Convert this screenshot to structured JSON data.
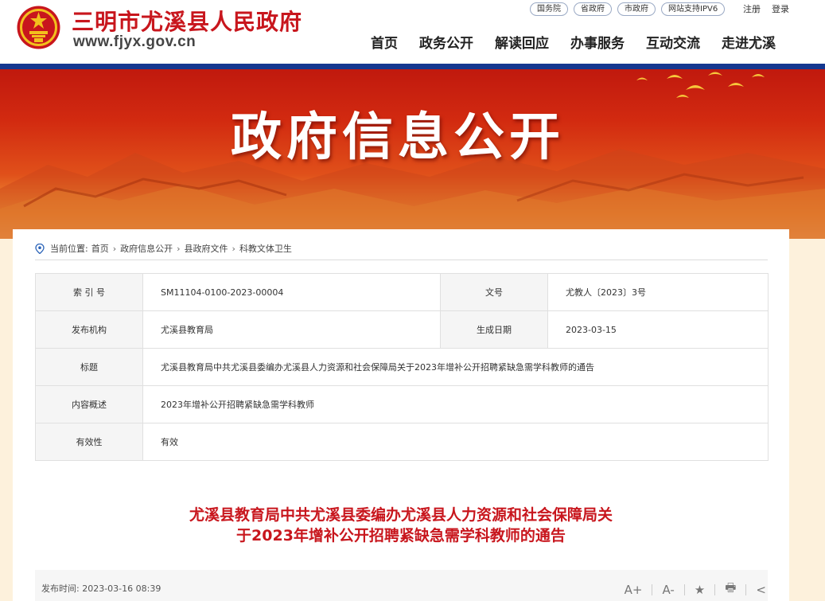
{
  "header": {
    "site_name": "三明市尤溪县人民政府",
    "domain": "www.fjyx.gov.cn",
    "top_links": [
      "国务院",
      "省政府",
      "市政府",
      "网站支持IPV6"
    ],
    "register": "注册",
    "login": "登录",
    "nav": [
      "首页",
      "政务公开",
      "解读回应",
      "办事服务",
      "互动交流",
      "走进尤溪"
    ],
    "bar_color": "#14378f"
  },
  "banner": {
    "title": "政府信息公开"
  },
  "breadcrumb": {
    "prefix": "当前位置:",
    "items": [
      "首页",
      "政府信息公开",
      "县政府文件",
      "科教文体卫生"
    ]
  },
  "meta": {
    "index_label": "索 引 号",
    "index_value": "SM11104-0100-2023-00004",
    "docno_label": "文号",
    "docno_value": "尤教人〔2023〕3号",
    "org_label": "发布机构",
    "org_value": "尤溪县教育局",
    "date_label": "生成日期",
    "date_value": "2023-03-15",
    "title_label": "标题",
    "title_value": "尤溪县教育局中共尤溪县委编办尤溪县人力资源和社会保障局关于2023年增补公开招聘紧缺急需学科教师的通告",
    "summary_label": "内容概述",
    "summary_value": "2023年增补公开招聘紧缺急需学科教师",
    "validity_label": "有效性",
    "validity_value": "有效"
  },
  "article": {
    "title_line1": "尤溪县教育局中共尤溪县委编办尤溪县人力资源和社会保障局关",
    "title_line2": "于2023年增补公开招聘紧缺急需学科教师的通告",
    "publish_time": "发布时间: 2023-03-16 08:39",
    "tools": {
      "font_up": "A+",
      "font_down": "A-",
      "favorite": "★",
      "print": "🖶",
      "share": "<"
    }
  },
  "colors": {
    "accent_red": "#c8161d",
    "page_bg": "#fdf1dc"
  }
}
